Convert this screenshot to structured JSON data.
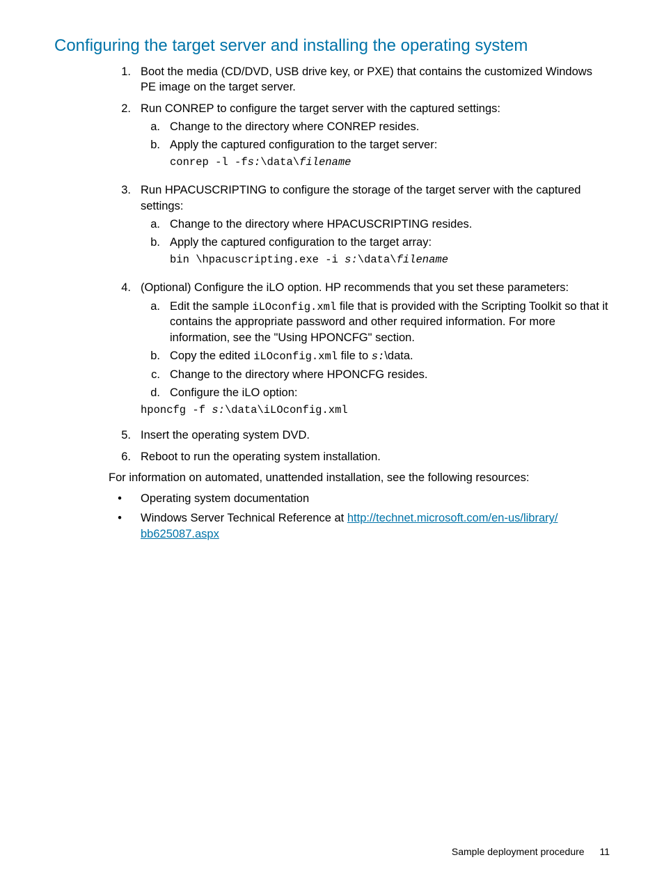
{
  "title": "Configuring the target server and installing the operating system",
  "steps": {
    "s1": "Boot the media (CD/DVD, USB drive key, or PXE) that contains the customized Windows PE image on the target server.",
    "s2": "Run CONREP to configure the target server with the captured settings:",
    "s2a": "Change to the directory where CONREP resides.",
    "s2b": "Apply the captured configuration to the target server:",
    "s2b_code_prefix": "conrep -l -f",
    "s2b_code_var1": "s:",
    "s2b_code_mid": "\\data\\",
    "s2b_code_var2": "filename",
    "s3": "Run HPACUSCRIPTING to configure the storage of the target server with the captured settings:",
    "s3a": "Change to the directory where HPACUSCRIPTING resides.",
    "s3b": "Apply the captured configuration to the target array:",
    "s3b_code_prefix": "bin \\hpacuscripting.exe -i ",
    "s3b_code_var1": "s:",
    "s3b_code_mid": "\\data\\",
    "s3b_code_var2": "filename",
    "s4": "(Optional) Configure the iLO option. HP recommends that you set these parameters:",
    "s4a_part1": "Edit the sample ",
    "s4a_code": "iLOconfig.xml",
    "s4a_part2": " file that is provided with the Scripting Toolkit so that it contains the appropriate password and other required information. For more information, see the \"Using HPONCFG\" section.",
    "s4b_part1": "Copy the edited ",
    "s4b_code": "iLOconfig.xml",
    "s4b_part2": " file to ",
    "s4b_var": "s:",
    "s4b_part3": "\\data.",
    "s4c": "Change to the directory where HPONCFG resides.",
    "s4d": "Configure the iLO option:",
    "s4_code_prefix": "hponcfg -f ",
    "s4_code_var": "s:",
    "s4_code_suffix": "\\data\\iLOconfig.xml",
    "s5": "Insert the operating system DVD.",
    "s6": "Reboot to run the operating system installation."
  },
  "para1": "For information on automated, unattended installation, see the following resources:",
  "bullets": {
    "b1": "Operating system documentation",
    "b2_prefix": "Windows Server Technical Reference at ",
    "b2_link1": "http://technet.microsoft.com/en-us/library/",
    "b2_link2": "bb625087.aspx"
  },
  "footer": {
    "label": "Sample deployment procedure",
    "page": "11"
  }
}
